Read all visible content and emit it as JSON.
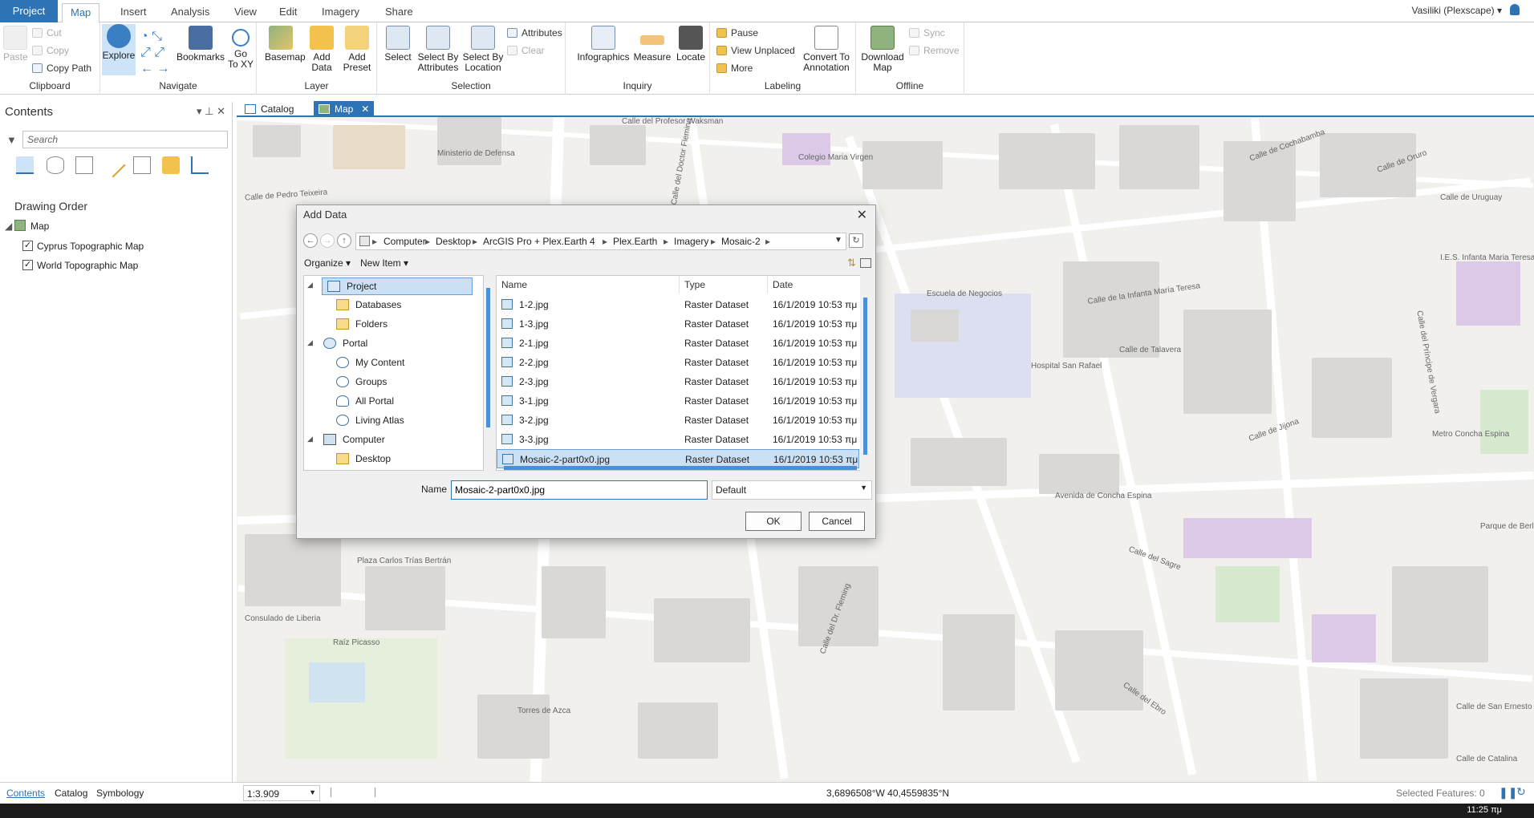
{
  "ribbon_tabs": {
    "project": "Project",
    "map": "Map",
    "insert": "Insert",
    "analysis": "Analysis",
    "view": "View",
    "edit": "Edit",
    "imagery": "Imagery",
    "share": "Share"
  },
  "user": "Vasiliki (Plexscape) ▾",
  "ribbon": {
    "clipboard": {
      "label": "Clipboard",
      "paste": "Paste",
      "cut": "Cut",
      "copy": "Copy",
      "copy_path": "Copy Path"
    },
    "navigate": {
      "label": "Navigate",
      "explore": "Explore",
      "bookmarks": "Bookmarks",
      "goto_xy": "Go\nTo XY"
    },
    "layer": {
      "label": "Layer",
      "basemap": "Basemap",
      "add_data": "Add\nData",
      "add_preset": "Add\nPreset"
    },
    "selection": {
      "label": "Selection",
      "select": "Select",
      "select_by_attributes": "Select By\nAttributes",
      "select_by_location": "Select By\nLocation",
      "attributes": "Attributes",
      "clear": "Clear"
    },
    "inquiry": {
      "label": "Inquiry",
      "infographics": "Infographics",
      "measure": "Measure",
      "locate": "Locate"
    },
    "labeling": {
      "label": "Labeling",
      "pause": "Pause",
      "view_unplaced": "View Unplaced",
      "more": "More",
      "convert_to_annotation": "Convert To\nAnnotation"
    },
    "offline": {
      "label": "Offline",
      "download_map": "Download\nMap",
      "sync": "Sync",
      "remove": "Remove"
    }
  },
  "contents": {
    "title": "Contents",
    "search_placeholder": "Search",
    "drawing_order": "Drawing Order",
    "map_node": "Map",
    "layers": [
      {
        "name": "Cyprus Topographic Map",
        "checked": true
      },
      {
        "name": "World Topographic Map",
        "checked": true
      }
    ]
  },
  "view_tabs": [
    {
      "label": "Catalog"
    },
    {
      "label": "Map"
    }
  ],
  "map_labels": [
    "Calle del Profesor Waksman",
    "Ministerio de Defensa",
    "Calle del Doctor Fleming",
    "Colegio Maria Virgen",
    "Calle de Cochabamba",
    "Calle de Oruro",
    "Calle de Uruguay",
    "Calle de Pedro Teixeira",
    "Escuela de Negocios",
    "Calle de la Infanta María Teresa",
    "Calle de Talavera",
    "Hospital San Rafael",
    "I.E.S. Infanta Maria Teresa",
    "Calle de Jijona",
    "Avenida de Concha Espina",
    "Plaza Carlos Trías Bertrán",
    "Consulado de Liberia",
    "Raíz Picasso",
    "Torres de Azca",
    "Calle del Sagre",
    "Calle del Ebro",
    "Calle de San Ernesto",
    "Calle de Catalina",
    "Calle del Príncipe de Vergara",
    "Parque de Berlín",
    "Metro Concha Espina",
    "Calle del Dr. Fleming"
  ],
  "dialog": {
    "title": "Add Data",
    "breadcrumb": [
      "Computer",
      "Desktop",
      "ArcGIS Pro + Plex.Earth 4",
      "Plex.Earth",
      "Imagery",
      "Mosaic-2"
    ],
    "organize": "Organize ▾",
    "new_item": "New Item ▾",
    "tree": [
      {
        "label": "Project",
        "level": 0,
        "selected": true
      },
      {
        "label": "Databases",
        "level": 1
      },
      {
        "label": "Folders",
        "level": 1
      },
      {
        "label": "Portal",
        "level": 0
      },
      {
        "label": "My Content",
        "level": 1
      },
      {
        "label": "Groups",
        "level": 1
      },
      {
        "label": "All Portal",
        "level": 1
      },
      {
        "label": "Living Atlas",
        "level": 1
      },
      {
        "label": "Computer",
        "level": 0
      },
      {
        "label": "Desktop",
        "level": 1
      }
    ],
    "columns": {
      "name": "Name",
      "type": "Type",
      "date": "Date"
    },
    "files": [
      {
        "name": "1-2.jpg",
        "type": "Raster Dataset",
        "date": "16/1/2019 10:53 πμ"
      },
      {
        "name": "1-3.jpg",
        "type": "Raster Dataset",
        "date": "16/1/2019 10:53 πμ"
      },
      {
        "name": "2-1.jpg",
        "type": "Raster Dataset",
        "date": "16/1/2019 10:53 πμ"
      },
      {
        "name": "2-2.jpg",
        "type": "Raster Dataset",
        "date": "16/1/2019 10:53 πμ"
      },
      {
        "name": "2-3.jpg",
        "type": "Raster Dataset",
        "date": "16/1/2019 10:53 πμ"
      },
      {
        "name": "3-1.jpg",
        "type": "Raster Dataset",
        "date": "16/1/2019 10:53 πμ"
      },
      {
        "name": "3-2.jpg",
        "type": "Raster Dataset",
        "date": "16/1/2019 10:53 πμ"
      },
      {
        "name": "3-3.jpg",
        "type": "Raster Dataset",
        "date": "16/1/2019 10:53 πμ"
      },
      {
        "name": "Mosaic-2-part0x0.jpg",
        "type": "Raster Dataset",
        "date": "16/1/2019 10:53 πμ",
        "selected": true
      }
    ],
    "name_label": "Name",
    "name_value": "Mosaic-2-part0x0.jpg",
    "filter_value": "Default",
    "ok": "OK",
    "cancel": "Cancel"
  },
  "status": {
    "scale": "1:3.909",
    "coords": "3,6896508°W 40,4559835°N",
    "selected_features": "Selected Features: 0",
    "tabs": [
      "Contents",
      "Catalog",
      "Symbology"
    ]
  },
  "clock": "11:25 πμ",
  "colors": {
    "accent": "#2e74b5",
    "selection": "#cce0f5"
  }
}
